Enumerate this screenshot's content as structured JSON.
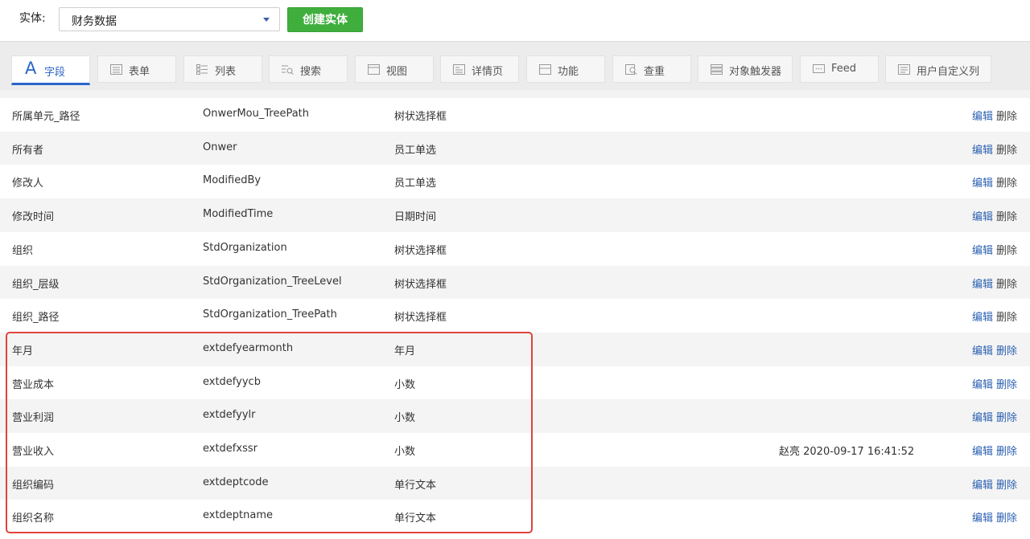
{
  "topbar": {
    "entity_label": "实体:",
    "entity_value": "财务数据",
    "create_button": "创建实体"
  },
  "tabs": [
    {
      "label": "字段",
      "icon": "field-icon",
      "active": true
    },
    {
      "label": "表单",
      "icon": "form-icon",
      "active": false
    },
    {
      "label": "列表",
      "icon": "list-icon",
      "active": false
    },
    {
      "label": "搜索",
      "icon": "search-icon",
      "active": false
    },
    {
      "label": "视图",
      "icon": "view-icon",
      "active": false
    },
    {
      "label": "详情页",
      "icon": "detail-icon",
      "active": false
    },
    {
      "label": "功能",
      "icon": "function-icon",
      "active": false
    },
    {
      "label": "查重",
      "icon": "dedupe-icon",
      "active": false
    },
    {
      "label": "对象触发器",
      "icon": "trigger-icon",
      "active": false
    },
    {
      "label": "Feed",
      "icon": "feed-icon",
      "active": false
    },
    {
      "label": "用户自定义列",
      "icon": "custom-column-icon",
      "active": false
    }
  ],
  "rows": [
    {
      "name": "所属单元_路径",
      "field": "OnwerMou_TreePath",
      "type": "树状选择框",
      "modified": "",
      "edit": "编辑",
      "delete": "删除"
    },
    {
      "name": "所有者",
      "field": "Onwer",
      "type": "员工单选",
      "modified": "",
      "edit": "编辑",
      "delete": "删除"
    },
    {
      "name": "修改人",
      "field": "ModifiedBy",
      "type": "员工单选",
      "modified": "",
      "edit": "编辑",
      "delete": "删除"
    },
    {
      "name": "修改时间",
      "field": "ModifiedTime",
      "type": "日期时间",
      "modified": "",
      "edit": "编辑",
      "delete": "删除"
    },
    {
      "name": "组织",
      "field": "StdOrganization",
      "type": "树状选择框",
      "modified": "",
      "edit": "编辑",
      "delete": "删除"
    },
    {
      "name": "组织_层级",
      "field": "StdOrganization_TreeLevel",
      "type": "树状选择框",
      "modified": "",
      "edit": "编辑",
      "delete": "删除"
    },
    {
      "name": "组织_路径",
      "field": "StdOrganization_TreePath",
      "type": "树状选择框",
      "modified": "",
      "edit": "编辑",
      "delete": "删除"
    },
    {
      "name": "年月",
      "field": "extdefyearmonth",
      "type": "年月",
      "modified": "",
      "edit": "编辑",
      "delete": "删除"
    },
    {
      "name": "营业成本",
      "field": "extdefyycb",
      "type": "小数",
      "modified": "",
      "edit": "编辑",
      "delete": "删除"
    },
    {
      "name": "营业利润",
      "field": "extdefyylr",
      "type": "小数",
      "modified": "",
      "edit": "编辑",
      "delete": "删除"
    },
    {
      "name": "营业收入",
      "field": "extdefxssr",
      "type": "小数",
      "modified": "赵亮 2020-09-17 16:41:52",
      "edit": "编辑",
      "delete": "删除"
    },
    {
      "name": "组织编码",
      "field": "extdeptcode",
      "type": "单行文本",
      "modified": "",
      "edit": "编辑",
      "delete": "删除"
    },
    {
      "name": "组织名称",
      "field": "extdeptname",
      "type": "单行文本",
      "modified": "",
      "edit": "编辑",
      "delete": "删除"
    }
  ],
  "colors": {
    "accent": "#2a64c8",
    "create_button": "#3fae3d",
    "highlight_border": "#e0443c"
  }
}
